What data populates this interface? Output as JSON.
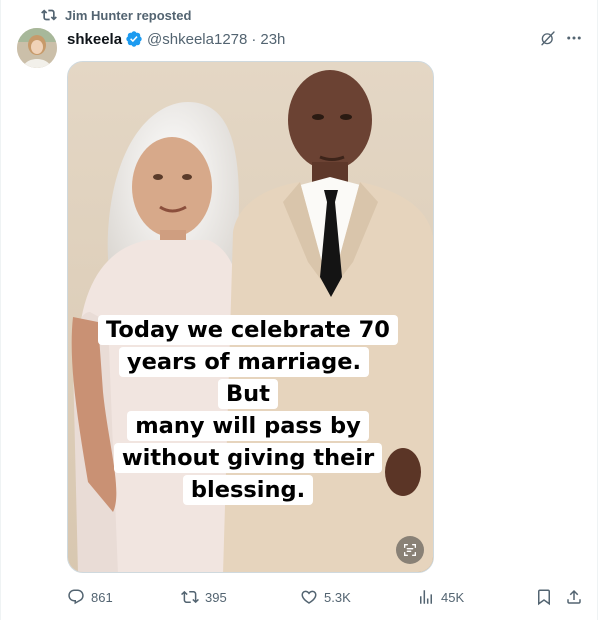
{
  "repost": {
    "text": "Jim Hunter reposted",
    "icon": "repost-icon"
  },
  "author": {
    "name": "shkeela",
    "verified": true,
    "handle": "@shkeela1278",
    "separator": "·",
    "time": "23h"
  },
  "media": {
    "caption_lines": [
      "Today we celebrate 70",
      "years of marriage. But",
      "many will pass by",
      "without giving their",
      "blessing."
    ]
  },
  "actions": {
    "replies": "861",
    "reposts": "395",
    "likes": "5.3K",
    "views": "45K"
  },
  "colors": {
    "text_primary": "#0f1419",
    "text_secondary": "#536471",
    "verified_blue": "#1d9bf0",
    "border": "#cfd9de"
  }
}
